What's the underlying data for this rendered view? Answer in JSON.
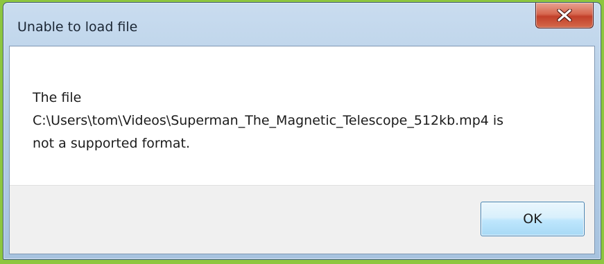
{
  "dialog": {
    "title": "Unable to load file",
    "message_lines": [
      "The file",
      "C:\\Users\\tom\\Videos\\Superman_The_Magnetic_Telescope_512kb.mp4 is",
      "not a supported format."
    ],
    "ok_label": "OK",
    "close_icon": "close-icon"
  },
  "colors": {
    "background": "#8dc63f",
    "close_button": "#c8452e",
    "ok_button_border": "#3c7fb1"
  }
}
